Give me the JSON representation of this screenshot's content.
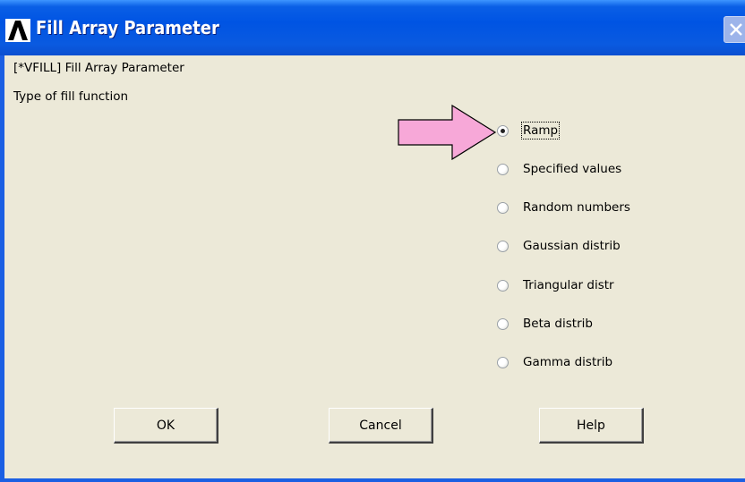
{
  "window": {
    "title": "Fill Array Parameter",
    "icon": "ansys-logo-icon",
    "close_icon": "close-icon"
  },
  "dialog": {
    "command_label": "[*VFILL]  Fill Array Parameter",
    "prompt_label": "Type of fill function",
    "options": [
      {
        "label": "Ramp",
        "selected": true
      },
      {
        "label": "Specified values",
        "selected": false
      },
      {
        "label": "Random numbers",
        "selected": false
      },
      {
        "label": "Gaussian distrib",
        "selected": false
      },
      {
        "label": "Triangular distr",
        "selected": false
      },
      {
        "label": "Beta distrib",
        "selected": false
      },
      {
        "label": "Gamma distrib",
        "selected": false
      }
    ]
  },
  "buttons": {
    "ok": "OK",
    "cancel": "Cancel",
    "help": "Help"
  },
  "annotation": {
    "arrow_color": "#f7a8d8",
    "arrow_icon": "pink-arrow-icon"
  },
  "colors": {
    "titlebar": "#0054e3",
    "dialog_bg": "#ece9d8"
  }
}
